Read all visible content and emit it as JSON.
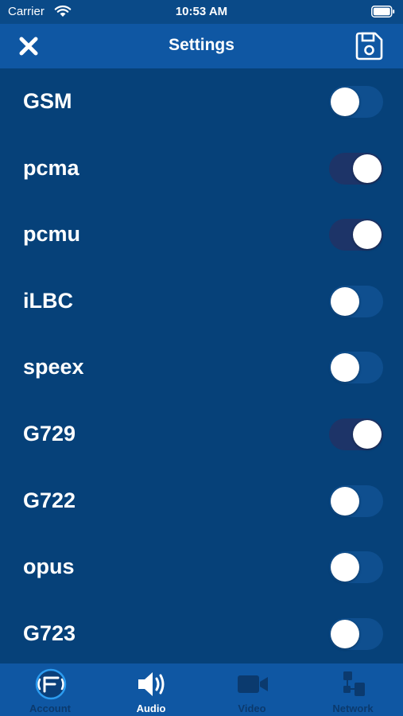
{
  "status_bar": {
    "carrier": "Carrier",
    "time": "10:53 AM"
  },
  "nav": {
    "title": "Settings",
    "close_icon": "close-icon",
    "save_icon": "save-icon"
  },
  "codecs": [
    {
      "label": "GSM",
      "enabled": false
    },
    {
      "label": "pcma",
      "enabled": true
    },
    {
      "label": "pcmu",
      "enabled": true
    },
    {
      "label": "iLBC",
      "enabled": false
    },
    {
      "label": "speex",
      "enabled": false
    },
    {
      "label": "G729",
      "enabled": true
    },
    {
      "label": "G722",
      "enabled": false
    },
    {
      "label": "opus",
      "enabled": false
    },
    {
      "label": "G723",
      "enabled": false
    }
  ],
  "tabs": [
    {
      "label": "Account",
      "icon": "account-logo-icon",
      "active": false
    },
    {
      "label": "Audio",
      "icon": "speaker-icon",
      "active": true
    },
    {
      "label": "Video",
      "icon": "video-camera-icon",
      "active": false
    },
    {
      "label": "Network",
      "icon": "network-icon",
      "active": false
    }
  ],
  "colors": {
    "background": "#064179",
    "bar": "#0f57a3",
    "toggle_on": "#1d3468",
    "toggle_off": "#0f4f8f",
    "inactive_tab": "#0b3a6e"
  }
}
